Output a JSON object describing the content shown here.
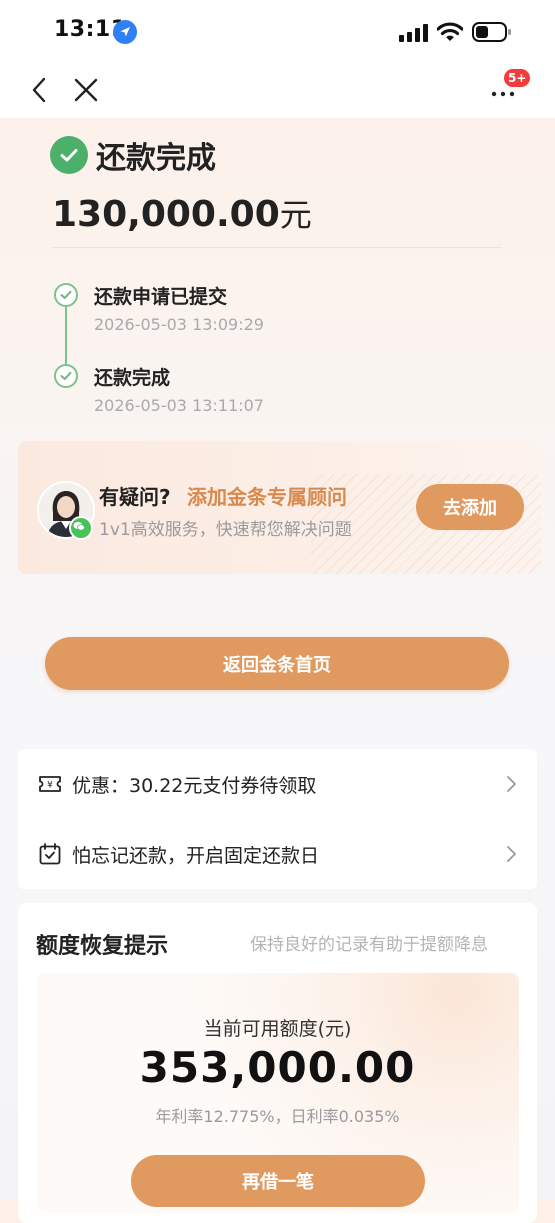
{
  "status_bar": {
    "time": "13:11"
  },
  "nav": {
    "badge": "5+"
  },
  "result": {
    "title": "还款完成",
    "amount": "130,000.00",
    "amount_unit": "元"
  },
  "timeline": [
    {
      "title": "还款申请已提交",
      "time": "2026-05-03 13:09:29"
    },
    {
      "title": "还款完成",
      "time": "2026-05-03 13:11:07"
    }
  ],
  "advisor": {
    "question": "有疑问?",
    "link": "添加金条专属顾问",
    "subtitle": "1v1高效服务，快速帮您解决问题",
    "button": "去添加"
  },
  "main_button": "返回金条首页",
  "list": [
    {
      "text": "优惠：30.22元支付券待领取",
      "icon": "ticket-icon"
    },
    {
      "text": "怕忘记还款，开启固定还款日",
      "icon": "calendar-icon"
    }
  ],
  "credit": {
    "title": "额度恢复提示",
    "hint": "保持良好的记录有助于提额降息",
    "label": "当前可用额度(元)",
    "amount": "353,000.00",
    "rate": "年利率12.775%，日利率0.035%",
    "button": "再借一笔"
  },
  "colors": {
    "accent": "#e09a5f",
    "accent_text": "#d8894e",
    "success": "#4caf6a"
  }
}
